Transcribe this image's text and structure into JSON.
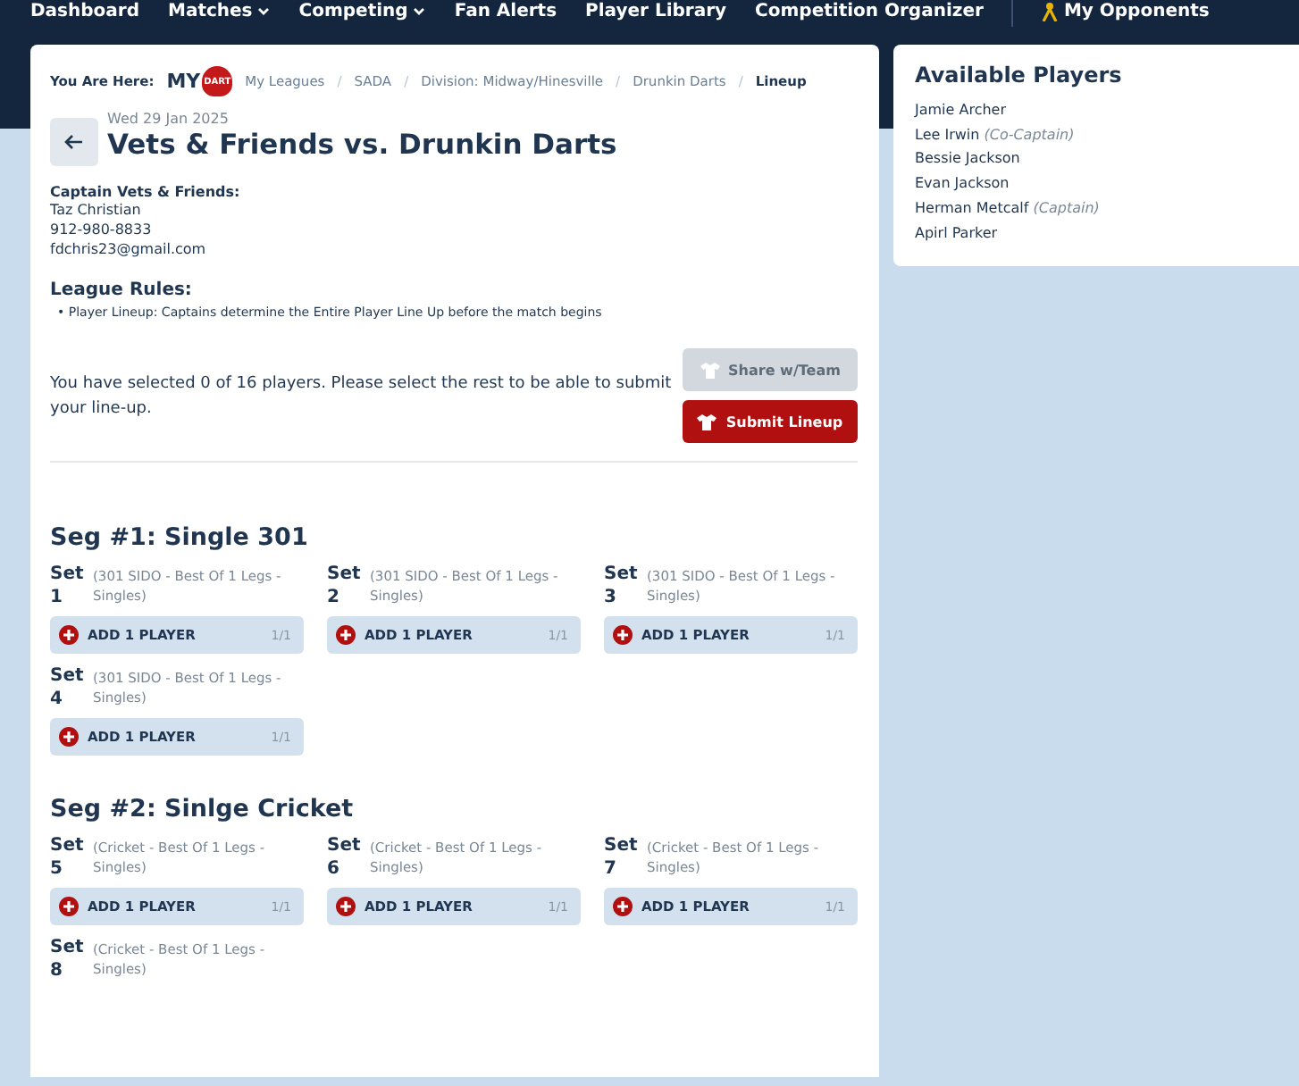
{
  "nav": {
    "items": [
      {
        "label": "Dashboard",
        "has_menu": false,
        "kind": "link"
      },
      {
        "label": "Matches",
        "has_menu": true,
        "kind": "link"
      },
      {
        "label": "Competing",
        "has_menu": true,
        "kind": "link"
      },
      {
        "label": "Fan Alerts",
        "has_menu": false,
        "kind": "link"
      },
      {
        "label": "Player Library",
        "has_menu": false,
        "kind": "link"
      },
      {
        "label": "Competition Organizer",
        "has_menu": false,
        "kind": "link"
      },
      {
        "label": "My Opponents",
        "has_menu": false,
        "kind": "opponents"
      }
    ]
  },
  "breadcrumb": {
    "label": "You Are Here:",
    "separator": "/",
    "logo": {
      "text": "MY",
      "badge": "DART"
    },
    "items": [
      {
        "label": "My Leagues",
        "current": false
      },
      {
        "label": "SADA",
        "current": false
      },
      {
        "label": "Division: Midway/Hinesville",
        "current": false
      },
      {
        "label": "Drunkin Darts",
        "current": false
      },
      {
        "label": "Lineup",
        "current": true
      }
    ]
  },
  "match": {
    "date": "Wed 29 Jan 2025",
    "title": "Vets & Friends vs. Drunkin Darts"
  },
  "captain": {
    "heading": "Captain Vets & Friends:",
    "lines": [
      "Taz Christian",
      "912-980-8833",
      "fdchris23@gmail.com"
    ]
  },
  "rules": {
    "heading": "League Rules:",
    "bullet": "•",
    "items": [
      "Player Lineup: Captains determine the Entire Player Line Up before the match begins"
    ]
  },
  "status": {
    "message": "You have selected 0 of 16 players. Please select the rest to be able to submit your line-up."
  },
  "actions": [
    {
      "label": "Share w/Team",
      "disabled": true
    },
    {
      "label": "Submit Lineup",
      "disabled": false
    }
  ],
  "segments": [
    {
      "title": "Seg #1: Single 301",
      "sets": [
        {
          "label": "Set",
          "number": "1",
          "format": "(301 SIDO - Best Of 1 Legs - Singles)",
          "slot": {
            "label": "ADD 1 PLAYER",
            "count": "1/1"
          }
        },
        {
          "label": "Set",
          "number": "2",
          "format": "(301 SIDO - Best Of 1 Legs - Singles)",
          "slot": {
            "label": "ADD 1 PLAYER",
            "count": "1/1"
          }
        },
        {
          "label": "Set",
          "number": "3",
          "format": "(301 SIDO - Best Of 1 Legs - Singles)",
          "slot": {
            "label": "ADD 1 PLAYER",
            "count": "1/1"
          }
        },
        {
          "label": "Set",
          "number": "4",
          "format": "(301 SIDO - Best Of 1 Legs - Singles)",
          "slot": {
            "label": "ADD 1 PLAYER",
            "count": "1/1"
          }
        }
      ]
    },
    {
      "title": "Seg #2: Sinlge Cricket",
      "sets": [
        {
          "label": "Set",
          "number": "5",
          "format": "(Cricket - Best Of 1 Legs - Singles)",
          "slot": {
            "label": "ADD 1 PLAYER",
            "count": "1/1"
          }
        },
        {
          "label": "Set",
          "number": "6",
          "format": "(Cricket - Best Of 1 Legs - Singles)",
          "slot": {
            "label": "ADD 1 PLAYER",
            "count": "1/1"
          }
        },
        {
          "label": "Set",
          "number": "7",
          "format": "(Cricket - Best Of 1 Legs - Singles)",
          "slot": {
            "label": "ADD 1 PLAYER",
            "count": "1/1"
          }
        },
        {
          "label": "Set",
          "number": "8",
          "format": "(Cricket - Best Of 1 Legs - Singles)"
        }
      ]
    }
  ],
  "available": {
    "title": "Available Players",
    "players": [
      {
        "name": "Jamie Archer"
      },
      {
        "name": "Lee Irwin",
        "role": "(Co-Captain)"
      },
      {
        "name": "Bessie Jackson"
      },
      {
        "name": "Evan Jackson"
      },
      {
        "name": "Herman Metcalf",
        "role": "(Captain)"
      },
      {
        "name": "Apirl Parker"
      }
    ]
  }
}
